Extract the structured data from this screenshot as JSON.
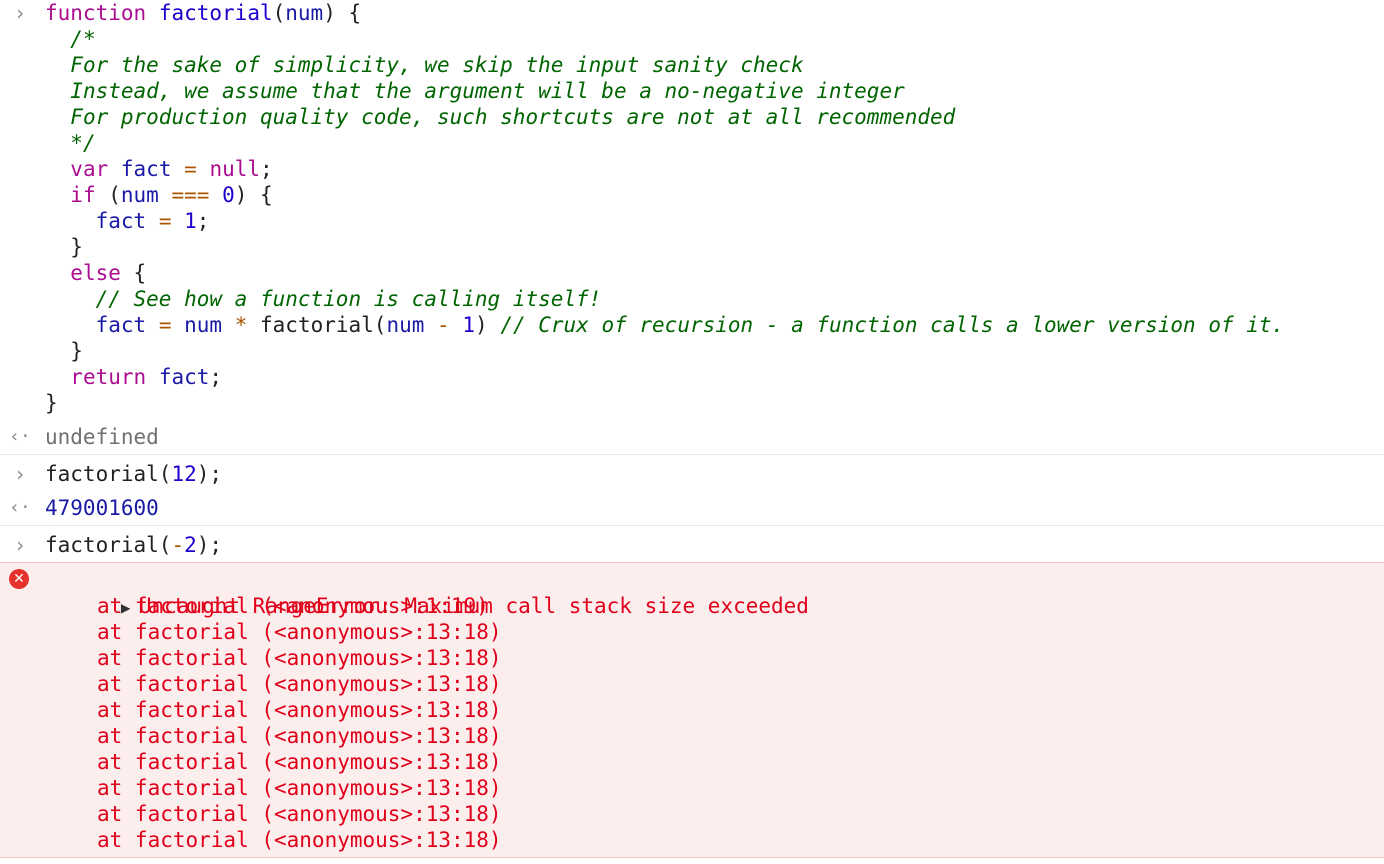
{
  "prompt_glyph": "›",
  "result_glyph": "‹·",
  "function_def": {
    "lines": [
      [
        [
          "kw",
          "function"
        ],
        [
          "pl",
          " "
        ],
        [
          "fn",
          "factorial"
        ],
        [
          "pl",
          "("
        ],
        [
          "id",
          "num"
        ],
        [
          "pl",
          ") {"
        ]
      ],
      [
        [
          "pl",
          "  "
        ],
        [
          "cm",
          "/*"
        ]
      ],
      [
        [
          "pl",
          "  "
        ],
        [
          "cm",
          "For the sake of simplicity, we skip the input sanity check"
        ]
      ],
      [
        [
          "pl",
          "  "
        ],
        [
          "cm",
          "Instead, we assume that the argument will be a no-negative integer"
        ]
      ],
      [
        [
          "pl",
          "  "
        ],
        [
          "cm",
          "For production quality code, such shortcuts are not at all recommended"
        ]
      ],
      [
        [
          "pl",
          "  "
        ],
        [
          "cm",
          "*/"
        ]
      ],
      [
        [
          "pl",
          "  "
        ],
        [
          "kw",
          "var"
        ],
        [
          "pl",
          " "
        ],
        [
          "id",
          "fact"
        ],
        [
          "pl",
          " "
        ],
        [
          "op",
          "="
        ],
        [
          "pl",
          " "
        ],
        [
          "kw",
          "null"
        ],
        [
          "pl",
          ";"
        ]
      ],
      [
        [
          "pl",
          "  "
        ],
        [
          "kw",
          "if"
        ],
        [
          "pl",
          " ("
        ],
        [
          "id",
          "num"
        ],
        [
          "pl",
          " "
        ],
        [
          "op",
          "==="
        ],
        [
          "pl",
          " "
        ],
        [
          "num",
          "0"
        ],
        [
          "pl",
          ") {"
        ]
      ],
      [
        [
          "pl",
          "    "
        ],
        [
          "id",
          "fact"
        ],
        [
          "pl",
          " "
        ],
        [
          "op",
          "="
        ],
        [
          "pl",
          " "
        ],
        [
          "num",
          "1"
        ],
        [
          "pl",
          ";"
        ]
      ],
      [
        [
          "pl",
          "  }"
        ]
      ],
      [
        [
          "pl",
          "  "
        ],
        [
          "kw",
          "else"
        ],
        [
          "pl",
          " {"
        ]
      ],
      [
        [
          "pl",
          "    "
        ],
        [
          "cm",
          "// See how a function is calling itself!"
        ]
      ],
      [
        [
          "pl",
          "    "
        ],
        [
          "id",
          "fact"
        ],
        [
          "pl",
          " "
        ],
        [
          "op",
          "="
        ],
        [
          "pl",
          " "
        ],
        [
          "id",
          "num"
        ],
        [
          "pl",
          " "
        ],
        [
          "op",
          "*"
        ],
        [
          "pl",
          " factorial("
        ],
        [
          "id",
          "num"
        ],
        [
          "pl",
          " "
        ],
        [
          "op",
          "-"
        ],
        [
          "pl",
          " "
        ],
        [
          "num",
          "1"
        ],
        [
          "pl",
          ") "
        ],
        [
          "cm",
          "// Crux of recursion - a function calls a lower version of it."
        ]
      ],
      [
        [
          "pl",
          "  }"
        ]
      ],
      [
        [
          "pl",
          "  "
        ],
        [
          "kw",
          "return"
        ],
        [
          "pl",
          " "
        ],
        [
          "id",
          "fact"
        ],
        [
          "pl",
          ";"
        ]
      ],
      [
        [
          "pl",
          "}"
        ]
      ]
    ],
    "result": "undefined"
  },
  "call_12": {
    "tokens": [
      [
        "pl",
        "factorial("
      ],
      [
        "num",
        "12"
      ],
      [
        "pl",
        ");"
      ]
    ],
    "result": "479001600"
  },
  "call_neg2": {
    "tokens": [
      [
        "pl",
        "factorial("
      ],
      [
        "op",
        "-"
      ],
      [
        "num",
        "2"
      ],
      [
        "pl",
        ");"
      ]
    ]
  },
  "error": {
    "icon_glyph": "✕",
    "expand_glyph": "▶",
    "message": "Uncaught RangeError: Maximum call stack size exceeded",
    "stack": [
      "at factorial (<anonymous>:1:19)",
      "at factorial (<anonymous>:13:18)",
      "at factorial (<anonymous>:13:18)",
      "at factorial (<anonymous>:13:18)",
      "at factorial (<anonymous>:13:18)",
      "at factorial (<anonymous>:13:18)",
      "at factorial (<anonymous>:13:18)",
      "at factorial (<anonymous>:13:18)",
      "at factorial (<anonymous>:13:18)",
      "at factorial (<anonymous>:13:18)"
    ]
  }
}
